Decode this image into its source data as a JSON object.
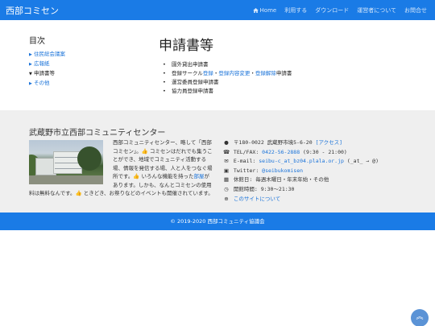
{
  "navbar": {
    "brand": "西部コミセン",
    "items": [
      "Home",
      "利用する",
      "ダウンロード",
      "運営者について",
      "お問合せ"
    ]
  },
  "toc": {
    "title": "目次",
    "items": [
      {
        "label": "住民総会議案",
        "current": false
      },
      {
        "label": "広報紙",
        "current": false
      },
      {
        "label": "申請書等",
        "current": true
      },
      {
        "label": "その他",
        "current": false
      }
    ]
  },
  "main": {
    "title": "申請書等",
    "list": {
      "item1": "園外貸出申請書",
      "item2_prefix": "登録サークル",
      "item2_link1": "登録",
      "item2_sep1": "・",
      "item2_link2": "登録内容変更",
      "item2_sep2": "・",
      "item2_link3": "登録解除",
      "item2_suffix": "申請書",
      "item3": "運営委員登録申請書",
      "item4": "協力員登録申請書"
    }
  },
  "footer": {
    "title": "武蔵野市立西部コミュニティセンター",
    "desc_part1": "西部コミュニティセンター、略して「西部コミセン」。",
    "desc_part2": " コミセンはだれでも集うことができ、地域でコミュニティ活動する場、情報を発信する場、人と人をつなぐ場所です。",
    "desc_part3": " いろんな機能を持った",
    "desc_link": "部屋",
    "desc_part4": "があります。しかも、なんとコミセンの使用料は無料なんです。",
    "desc_part5": " ときどき、お祭りなどのイベントも開催されています。",
    "address": "〒180-0022 武蔵野市境5-6-20",
    "access_link": "[アクセス]",
    "tel_label": "TEL/FAX:",
    "tel": "0422-56-2888",
    "tel_hours": "(9:30 - 21:00)",
    "email_label": "E-mail:",
    "email": "seibu-c_at_bz04.plala.or.jp",
    "email_note": "(_at_ → @)",
    "twitter_label": "Twitter:",
    "twitter": "@seibukomisen",
    "closed": "休館日: 毎週木曜日・年末年始・その他",
    "hours": "開館時間: 9:30〜21:30",
    "about_link": "このサイトについて"
  },
  "copyright": "© 2019-2020 西部コミュニティ協議会",
  "colors": {
    "navbar": "#1a7be6",
    "link": "#1a73d9",
    "footer_bg": "#efefef"
  }
}
